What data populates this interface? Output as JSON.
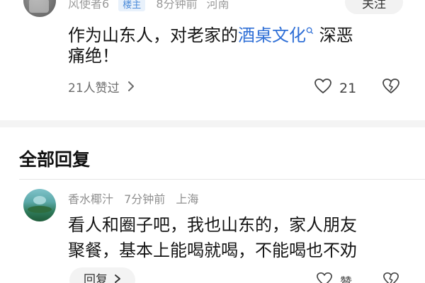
{
  "top_comment": {
    "author": "风使者6",
    "badge": "楼主",
    "time": "8分钟前",
    "location": "河南",
    "follow_label": "关注",
    "text_line1_prefix": "作为山东人，对老家的",
    "link_text": "酒桌文化",
    "link_sup": "Q",
    "text_line1_suffix": " 深恶",
    "text_line2": "痛绝！",
    "liked_by": "21人赞过",
    "like_count": "21"
  },
  "section": {
    "title": "全部回复"
  },
  "reply": {
    "author": "香水椰汁",
    "time": "7分钟前",
    "location": "上海",
    "text_line1": "看人和圈子吧，我也山东的，家人朋友",
    "text_line2": "聚餐，基本上能喝就喝，不能喝也不劝",
    "reply_label": "回复",
    "like_label": "赞"
  },
  "colors": {
    "link": "#2f6fd6",
    "badge_bg": "#e8f1fb",
    "badge_text": "#4a8ad8"
  },
  "icons": [
    "chevron-right-icon",
    "heart-icon",
    "broken-heart-icon",
    "search-icon"
  ]
}
